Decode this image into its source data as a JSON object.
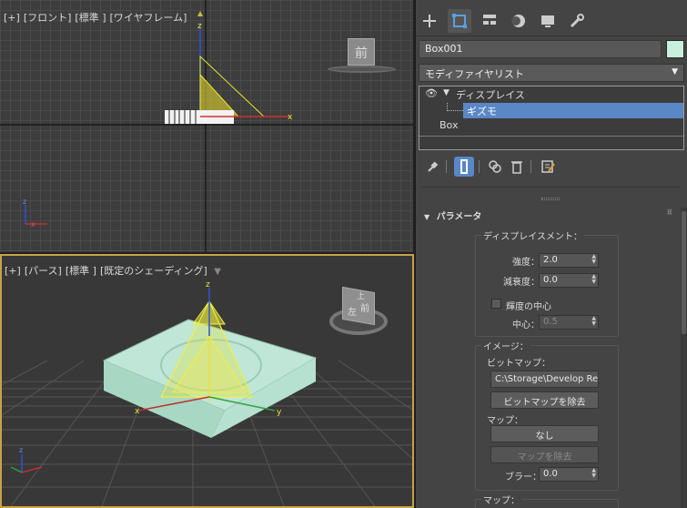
{
  "viewports": {
    "front": {
      "labels": [
        "[+]",
        "[フロント]",
        "[標準 ]",
        "[ワイヤフレーム]"
      ],
      "viewcube_label": "前"
    },
    "perspective": {
      "labels": [
        "[+]",
        "[パース]",
        "[標準 ]",
        "[既定のシェーディング]"
      ],
      "viewcube_face_front": "前",
      "viewcube_face_left": "左",
      "viewcube_face_top": "上"
    },
    "axis_x": "x",
    "axis_y": "y",
    "axis_z": "z"
  },
  "panel": {
    "tabs": [
      "create-icon",
      "modify-icon",
      "hierarchy-icon",
      "motion-icon",
      "display-icon",
      "utilities-icon"
    ],
    "object_name": "Box001",
    "object_color": "#c8f0dc",
    "modifier_list": "モディファイヤリスト",
    "stack": {
      "modifier": "ディスプレイス",
      "sub": "ギズモ",
      "base": "Box"
    },
    "parameters": {
      "title": "パラメータ",
      "displacement_group": "ディスプレイスメント：",
      "strength_label": "強度：",
      "strength_value": "2.0",
      "decay_label": "減衰度：",
      "decay_value": "0.0",
      "luminance_center_label": "輝度の中心",
      "center_label": "中心：",
      "center_value": "0.5",
      "image_group": "イメージ：",
      "bitmap_label": "ビットマップ：",
      "bitmap_path": "C:\\Storage\\Develop Rep",
      "remove_bitmap": "ビットマップを除去",
      "map_label": "マップ：",
      "map_none": "なし",
      "remove_map": "マップを除去",
      "blur_label": "ブラー：",
      "blur_value": "0.0",
      "map_group2": "マップ："
    }
  }
}
